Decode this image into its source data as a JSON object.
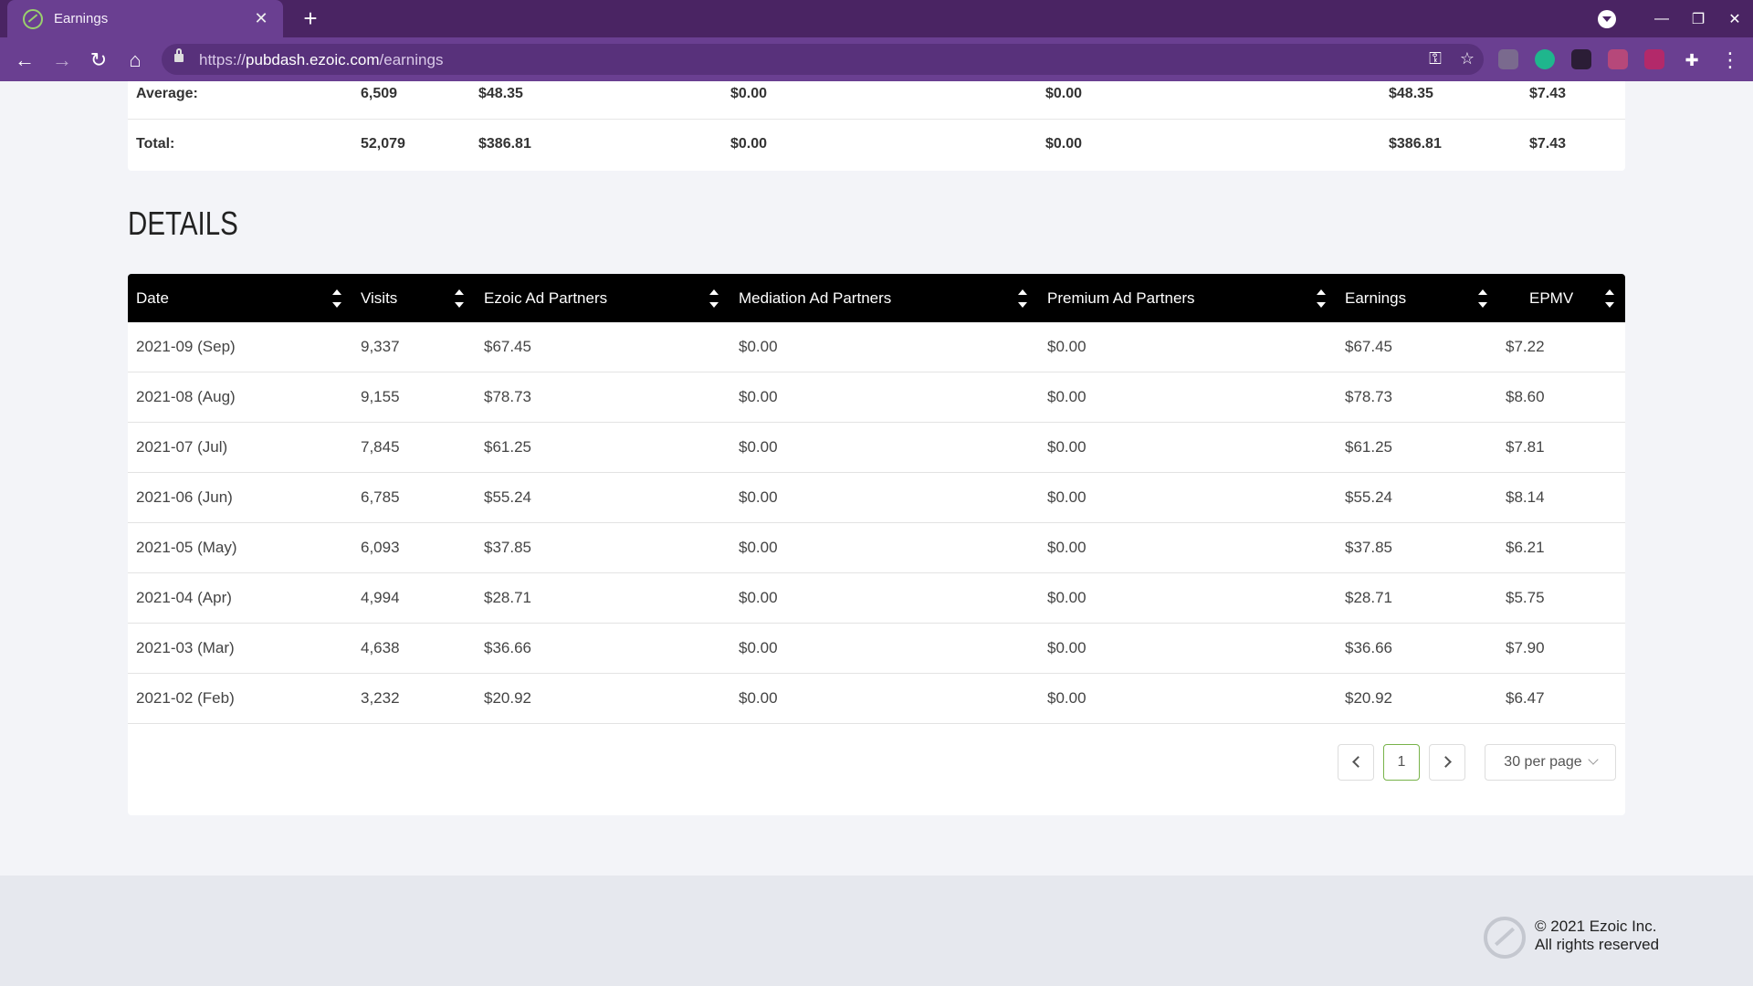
{
  "browser": {
    "tab_title": "Earnings",
    "url_scheme": "https://",
    "url_host": "pubdash.ezoic.com",
    "url_path": "/earnings"
  },
  "summary": {
    "rows": [
      {
        "label": "Average:",
        "visits": "6,509",
        "ezoic": "$48.35",
        "mediation": "$0.00",
        "premium": "$0.00",
        "earnings": "$48.35",
        "epmv": "$7.43"
      },
      {
        "label": "Total:",
        "visits": "52,079",
        "ezoic": "$386.81",
        "mediation": "$0.00",
        "premium": "$0.00",
        "earnings": "$386.81",
        "epmv": "$7.43"
      }
    ]
  },
  "details": {
    "title": "DETAILS",
    "columns": [
      "Date",
      "Visits",
      "Ezoic Ad Partners",
      "Mediation Ad Partners",
      "Premium Ad Partners",
      "Earnings",
      "EPMV"
    ],
    "rows": [
      {
        "date": "2021-09 (Sep)",
        "visits": "9,337",
        "ezoic": "$67.45",
        "mediation": "$0.00",
        "premium": "$0.00",
        "earnings": "$67.45",
        "epmv": "$7.22"
      },
      {
        "date": "2021-08 (Aug)",
        "visits": "9,155",
        "ezoic": "$78.73",
        "mediation": "$0.00",
        "premium": "$0.00",
        "earnings": "$78.73",
        "epmv": "$8.60"
      },
      {
        "date": "2021-07 (Jul)",
        "visits": "7,845",
        "ezoic": "$61.25",
        "mediation": "$0.00",
        "premium": "$0.00",
        "earnings": "$61.25",
        "epmv": "$7.81"
      },
      {
        "date": "2021-06 (Jun)",
        "visits": "6,785",
        "ezoic": "$55.24",
        "mediation": "$0.00",
        "premium": "$0.00",
        "earnings": "$55.24",
        "epmv": "$8.14"
      },
      {
        "date": "2021-05 (May)",
        "visits": "6,093",
        "ezoic": "$37.85",
        "mediation": "$0.00",
        "premium": "$0.00",
        "earnings": "$37.85",
        "epmv": "$6.21"
      },
      {
        "date": "2021-04 (Apr)",
        "visits": "4,994",
        "ezoic": "$28.71",
        "mediation": "$0.00",
        "premium": "$0.00",
        "earnings": "$28.71",
        "epmv": "$5.75"
      },
      {
        "date": "2021-03 (Mar)",
        "visits": "4,638",
        "ezoic": "$36.66",
        "mediation": "$0.00",
        "premium": "$0.00",
        "earnings": "$36.66",
        "epmv": "$7.90"
      },
      {
        "date": "2021-02 (Feb)",
        "visits": "3,232",
        "ezoic": "$20.92",
        "mediation": "$0.00",
        "premium": "$0.00",
        "earnings": "$20.92",
        "epmv": "$6.47"
      }
    ]
  },
  "pagination": {
    "current_page": "1",
    "per_page": "30 per page"
  },
  "footer": {
    "copyright": "© 2021 Ezoic Inc.",
    "rights": "All rights reserved"
  },
  "colors": {
    "tab_bar": "#4a2463",
    "toolbar": "#6a3f91",
    "table_header": "#000000",
    "active_page_border": "#78b34a"
  }
}
